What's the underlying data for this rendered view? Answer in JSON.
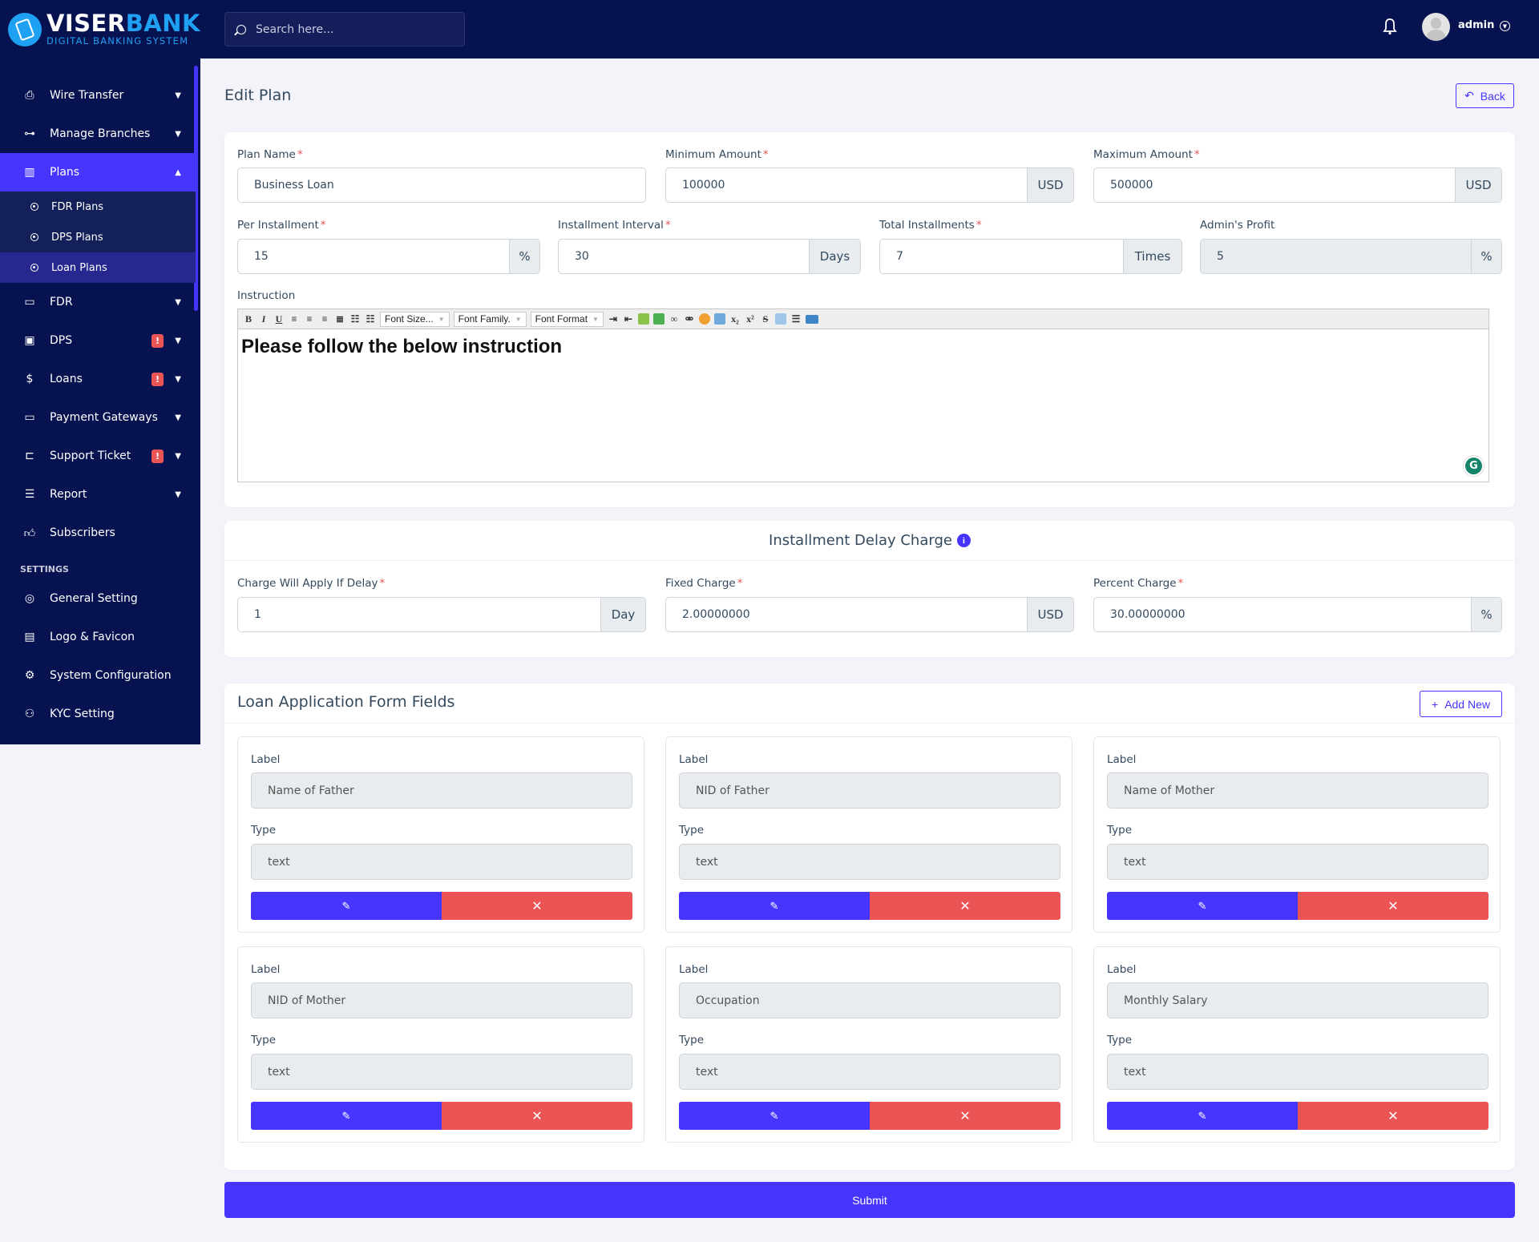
{
  "brand": {
    "name_white": "VISER",
    "name_blue": "BANK",
    "tagline": "DIGITAL BANKING SYSTEM"
  },
  "colors": {
    "sidebar_bg": "#071251",
    "accent": "#4634ff",
    "danger": "#ea5455",
    "page_bg": "#f3f3f9"
  },
  "header": {
    "search_placeholder": "Search here...",
    "user_name": "admin",
    "icons": {
      "search": "search-icon",
      "notifications": "bell-icon",
      "user_menu": "chevron-down-circle-icon"
    }
  },
  "sidebar": {
    "items": [
      {
        "label": "Wire Transfer",
        "icon": "wire-transfer-icon",
        "chevron": "down"
      },
      {
        "label": "Manage Branches",
        "icon": "branches-icon",
        "chevron": "down"
      },
      {
        "label": "Plans",
        "icon": "chart-bar-icon",
        "chevron": "up",
        "active": true,
        "children": [
          {
            "label": "FDR Plans"
          },
          {
            "label": "DPS Plans"
          },
          {
            "label": "Loan Plans",
            "active": true
          }
        ]
      },
      {
        "label": "FDR",
        "icon": "money-bill-icon",
        "chevron": "down"
      },
      {
        "label": "DPS",
        "icon": "box-icon",
        "chevron": "down",
        "badge": "!"
      },
      {
        "label": "Loans",
        "icon": "hand-dollar-icon",
        "chevron": "down",
        "badge": "!"
      },
      {
        "label": "Payment Gateways",
        "icon": "credit-card-icon",
        "chevron": "down"
      },
      {
        "label": "Support Ticket",
        "icon": "ticket-icon",
        "chevron": "down",
        "badge": "!"
      },
      {
        "label": "Report",
        "icon": "list-icon",
        "chevron": "down"
      },
      {
        "label": "Subscribers",
        "icon": "thumbs-up-icon"
      }
    ],
    "settings_title": "SETTINGS",
    "settings_items": [
      {
        "label": "General Setting",
        "icon": "life-ring-icon"
      },
      {
        "label": "Logo & Favicon",
        "icon": "images-icon"
      },
      {
        "label": "System Configuration",
        "icon": "cog-icon"
      },
      {
        "label": "KYC Setting",
        "icon": "user-check-icon"
      }
    ]
  },
  "page": {
    "title": "Edit Plan",
    "back_label": "Back"
  },
  "plan_form": {
    "plan_name": {
      "label": "Plan Name",
      "value": "Business Loan",
      "required": true
    },
    "minimum_amount": {
      "label": "Minimum Amount",
      "value": "100000",
      "addon": "USD",
      "required": true
    },
    "maximum_amount": {
      "label": "Maximum Amount",
      "value": "500000",
      "addon": "USD",
      "required": true
    },
    "per_installment": {
      "label": "Per Installment",
      "value": "15",
      "addon": "%",
      "required": true
    },
    "installment_interval": {
      "label": "Installment Interval",
      "value": "30",
      "addon": "Days",
      "required": true
    },
    "total_installments": {
      "label": "Total Installments",
      "value": "7",
      "addon": "Times",
      "required": true
    },
    "admins_profit": {
      "label": "Admin's Profit",
      "value": "5",
      "addon": "%",
      "disabled": true
    },
    "instruction": {
      "label": "Instruction",
      "content": "Please follow the below instruction",
      "toolbar": {
        "font_size": "Font Size...",
        "font_family": "Font Family.",
        "font_format": "Font Format"
      }
    }
  },
  "delay_charge": {
    "title": "Installment Delay Charge",
    "charge_delay": {
      "label": "Charge Will Apply If Delay",
      "value": "1",
      "addon": "Day",
      "required": true
    },
    "fixed_charge": {
      "label": "Fixed Charge",
      "value": "2.00000000",
      "addon": "USD",
      "required": true
    },
    "percent_charge": {
      "label": "Percent Charge",
      "value": "30.00000000",
      "addon": "%",
      "required": true
    }
  },
  "form_fields": {
    "title": "Loan Application Form Fields",
    "add_new_label": "Add New",
    "label_caption": "Label",
    "type_caption": "Type",
    "fields": [
      {
        "label": "Name of Father",
        "type": "text"
      },
      {
        "label": "NID of Father",
        "type": "text"
      },
      {
        "label": "Name of Mother",
        "type": "text"
      },
      {
        "label": "NID of Mother",
        "type": "text"
      },
      {
        "label": "Occupation",
        "type": "text"
      },
      {
        "label": "Monthly Salary",
        "type": "text"
      }
    ]
  },
  "submit_label": "Submit"
}
